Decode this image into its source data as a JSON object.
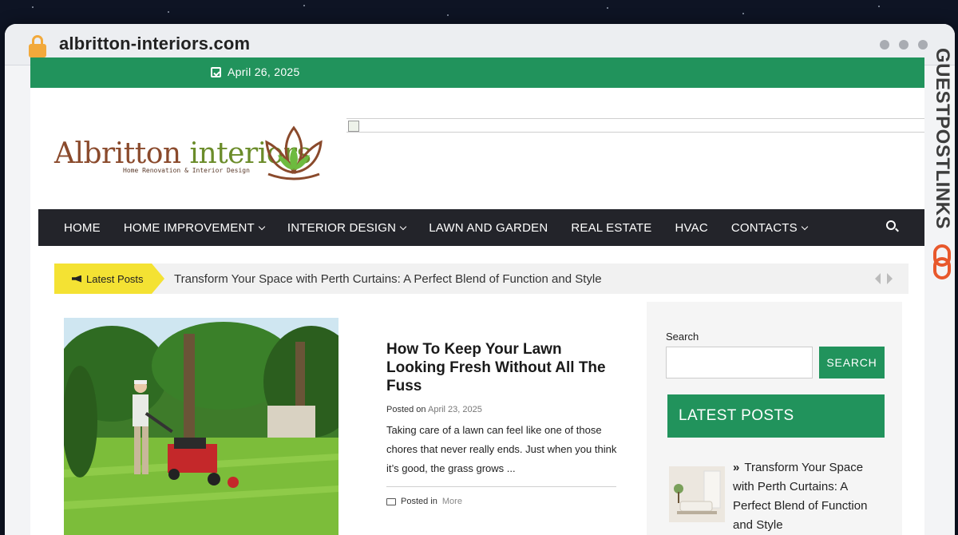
{
  "browser": {
    "url": "albritton-interiors.com"
  },
  "site": {
    "date": "April 26, 2025",
    "logo": {
      "name_part1": "Albritton ",
      "name_part2": "interiors",
      "tagline": "Home Renovation & Interior Design"
    },
    "nav": {
      "items": [
        {
          "label": "HOME",
          "dropdown": false
        },
        {
          "label": "HOME IMPROVEMENT",
          "dropdown": true
        },
        {
          "label": "INTERIOR DESIGN",
          "dropdown": true
        },
        {
          "label": "LAWN AND GARDEN",
          "dropdown": false
        },
        {
          "label": "REAL ESTATE",
          "dropdown": false
        },
        {
          "label": "HVAC",
          "dropdown": false
        },
        {
          "label": "CONTACTS",
          "dropdown": true
        }
      ]
    },
    "ticker": {
      "label": "Latest Posts",
      "text": "Transform Your Space with Perth Curtains: A Perfect Blend of Function and Style"
    },
    "post": {
      "title": "How To Keep Your Lawn Looking Fresh Without All The Fuss",
      "posted_on_label": "Posted on",
      "date": "April 23, 2025",
      "excerpt": "Taking care of a lawn can feel like one of those chores that never really ends. Just when you think it’s good, the grass grows ...",
      "posted_in_label": "Posted in",
      "category": "More"
    },
    "sidebar": {
      "search_label": "Search",
      "search_placeholder": "",
      "search_button": "SEARCH",
      "latest_title": "LATEST POSTS",
      "latest_post": "Transform Your Space with Perth Curtains: A Perfect Blend of Function and Style",
      "bullet": "»"
    }
  },
  "watermark": {
    "text": "GUESTPOSTLINKS"
  },
  "colors": {
    "accent_green": "#21935c",
    "nav_dark": "#23242a",
    "ticker_yellow": "#f4e233",
    "lock_orange": "#f2a93b"
  }
}
